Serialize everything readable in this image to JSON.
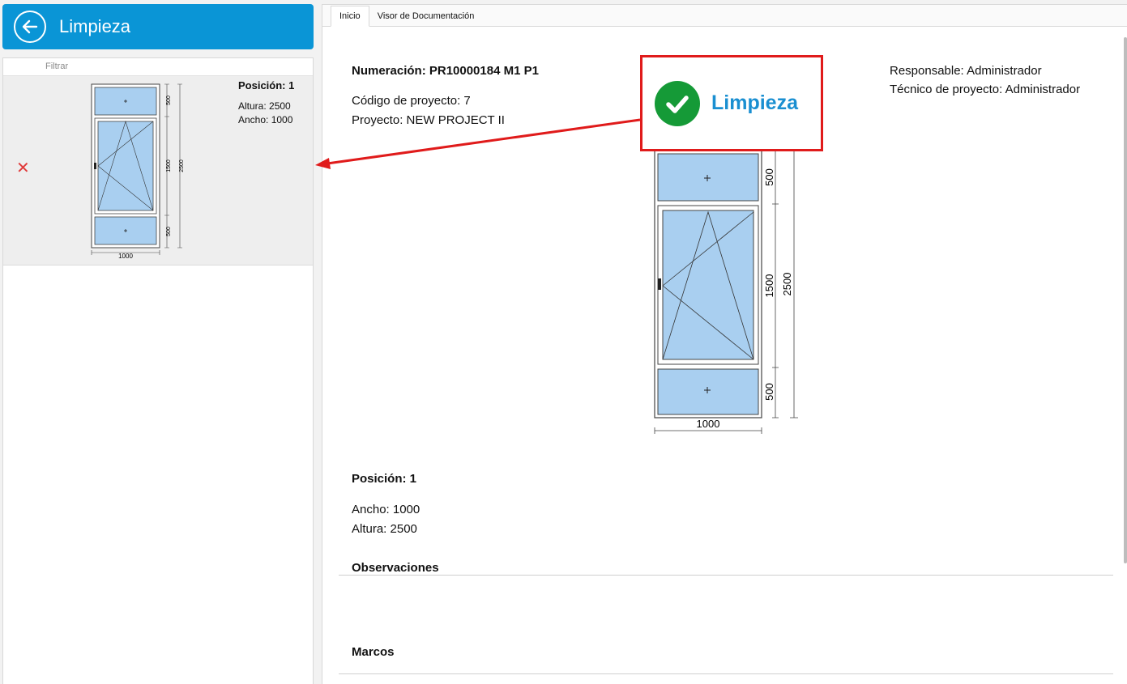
{
  "header": {
    "title": "Limpieza"
  },
  "sidebar": {
    "filter_placeholder": "Filtrar",
    "items": [
      {
        "title": "Posición: 1",
        "height": "Altura: 2500",
        "width": "Ancho: 1000",
        "dims": {
          "top": "500",
          "middle": "1500",
          "bottom": "500",
          "total": "2500",
          "width": "1000"
        }
      }
    ]
  },
  "tabs": [
    {
      "label": "Inicio"
    },
    {
      "label": "Visor de Documentación"
    }
  ],
  "detail": {
    "numeracion": "Numeración: PR10000184 M1 P1",
    "codigo": "Código de proyecto: 7",
    "proyecto": "Proyecto: NEW PROJECT II",
    "responsable": "Responsable: Administrador",
    "tecnico": "Técnico de proyecto: Administrador",
    "posicion": "Posición: 1",
    "ancho": "Ancho: 1000",
    "altura": "Altura: 2500",
    "observaciones": "Observaciones",
    "marcos": "Marcos",
    "dims": {
      "top": "500",
      "middle": "1500",
      "bottom": "500",
      "total": "2500",
      "width": "1000"
    }
  },
  "callout": {
    "label": "Limpieza"
  },
  "colors": {
    "header": "#0a95d6",
    "callout_border": "#e01b1b",
    "check": "#159a37",
    "glass": "#a9cff0"
  }
}
